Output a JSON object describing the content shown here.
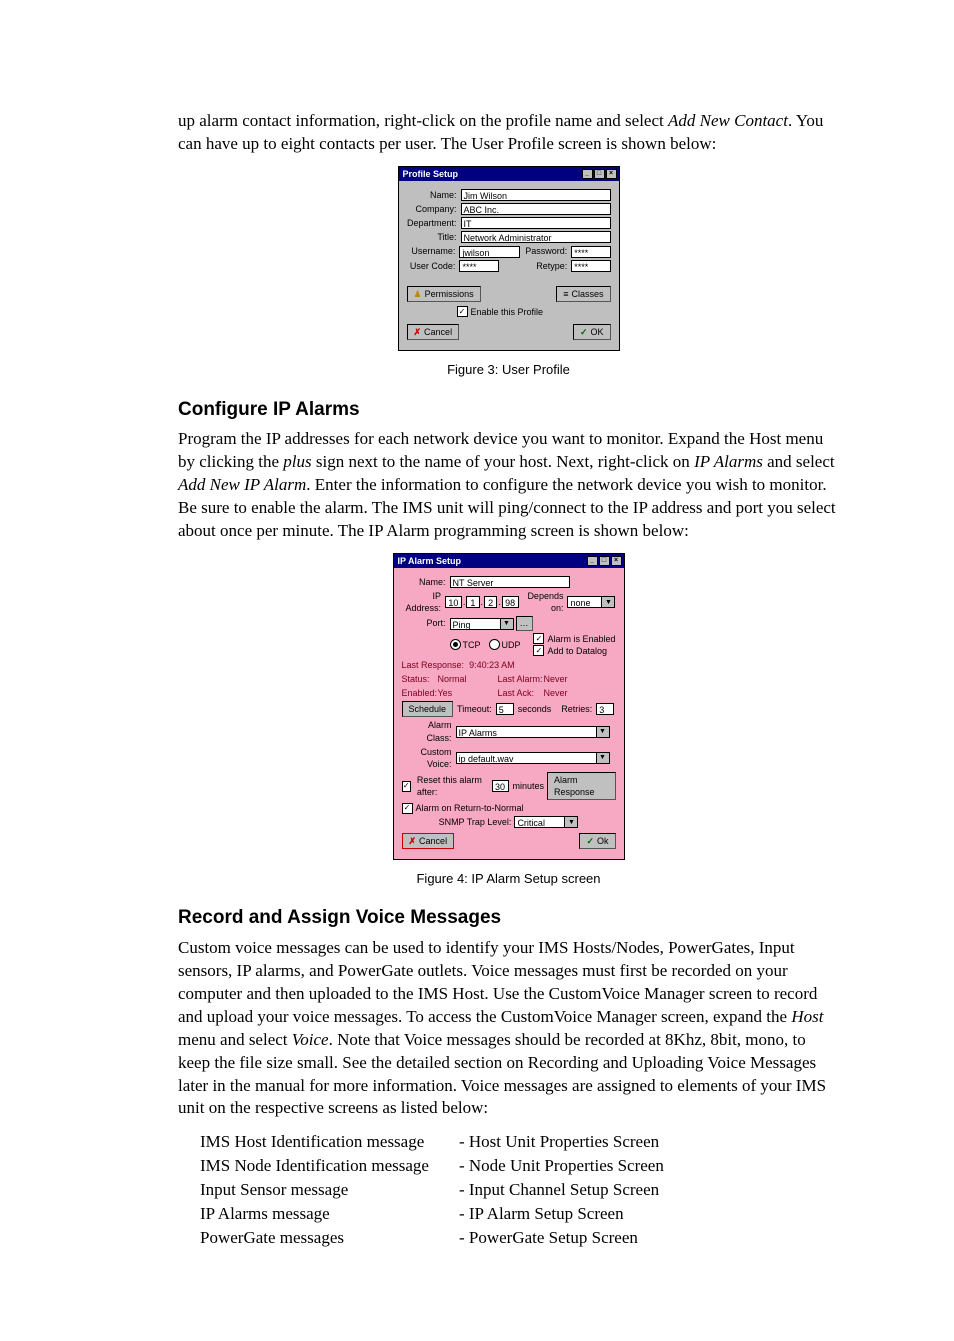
{
  "intro": {
    "p1a": "up alarm contact information, right-click on the profile name and select ",
    "p1_em": "Add New Contact",
    "p1b": ". You can have up to eight contacts per user. The User Profile screen is shown below:"
  },
  "fig3": {
    "caption": "Figure 3: User Profile",
    "title": "Profile Setup",
    "labels": {
      "name": "Name:",
      "company": "Company:",
      "department": "Department:",
      "title": "Title:",
      "username": "Username:",
      "password": "Password:",
      "usercode": "User Code:",
      "retype": "Retype:"
    },
    "values": {
      "name": "Jim Wilson",
      "company": "ABC Inc.",
      "department": "IT",
      "title": "Network Administrator",
      "username": "jwilson",
      "password": "****",
      "usercode": "****",
      "retype": "****"
    },
    "buttons": {
      "permissions": "Permissions",
      "classes": "Classes",
      "enable": "Enable this Profile",
      "cancel": "Cancel",
      "ok": "OK"
    }
  },
  "sec1": {
    "heading": "Configure IP Alarms",
    "p_a": "Program the IP addresses for each network device you want to monitor.  Expand the Host menu by clicking the ",
    "p_em1": "plus",
    "p_b": " sign next to the name of your host.  Next, right-click on ",
    "p_em2": "IP Alarms",
    "p_c": " and select ",
    "p_em3": "Add New IP Alarm",
    "p_d": ".   Enter the information to configure the network device you wish to monitor. Be sure to enable the alarm. The IMS unit will ping/connect to the IP address and port you select about once per minute.  The IP Alarm programming screen is shown below:"
  },
  "fig4": {
    "caption": "Figure 4: IP Alarm Setup screen",
    "title": "IP Alarm Setup",
    "labels": {
      "name": "Name:",
      "ip": "IP Address:",
      "depends": "Depends on:",
      "port": "Port:",
      "tcp": "TCP",
      "udp": "UDP",
      "alarm_enabled": "Alarm is Enabled",
      "add_datalog": "Add to Datalog",
      "last_response": "Last Response:",
      "status": "Status:",
      "enabled": "Enabled:",
      "last_alarm": "Last Alarm:",
      "last_ack": "Last Ack:",
      "schedule": "Schedule",
      "timeout": "Timeout:",
      "seconds": "seconds",
      "retries": "Retries:",
      "alarm_class": "Alarm Class:",
      "custom_voice": "Custom Voice:",
      "reset_after": "Reset this alarm after:",
      "minutes": "minutes",
      "alarm_response": "Alarm Response",
      "alarm_return": "Alarm on Return-to-Normal",
      "snmp": "SNMP Trap Level:",
      "cancel": "Cancel",
      "ok": "Ok"
    },
    "values": {
      "name": "NT Server",
      "ip1": "10",
      "ip2": "1",
      "ip3": "2",
      "ip4": "98",
      "depends": "none",
      "port": "Ping",
      "last_response": "9:40:23 AM",
      "status": "Normal",
      "enabled": "Yes",
      "last_alarm": "Never",
      "last_ack": "Never",
      "timeout": "5",
      "retries": "3",
      "alarm_class": "IP Alarms",
      "custom_voice": "ip default.wav",
      "reset_after": "30",
      "snmp": "Critical"
    }
  },
  "sec2": {
    "heading": "Record and Assign Voice Messages",
    "p_a": "Custom voice messages can be used to identify your IMS Hosts/Nodes, PowerGates, Input sensors, IP alarms, and PowerGate outlets. Voice messages must first be recorded on your computer and then uploaded to the IMS Host. Use the CustomVoice Manager screen to record and upload your voice messages. To access the CustomVoice Manager screen, expand the ",
    "p_em1": "Host",
    "p_b": " menu and select ",
    "p_em2": "Voice",
    "p_c": ".  Note that Voice messages should be recorded at 8Khz, 8bit, mono, to keep the file size small.  See the detailed section on Recording and Uploading Voice Messages later in the manual for more information.  Voice messages are assigned to elements of your IMS unit on the respective screens as listed below:"
  },
  "map": {
    "left": [
      "IMS Host Identification message",
      "IMS Node Identification message",
      "Input Sensor message",
      "IP Alarms message",
      "PowerGate messages"
    ],
    "right": [
      "- Host Unit Properties Screen",
      "- Node Unit Properties Screen",
      "- Input Channel Setup Screen",
      "- IP Alarm Setup Screen",
      "- PowerGate Setup Screen"
    ]
  }
}
